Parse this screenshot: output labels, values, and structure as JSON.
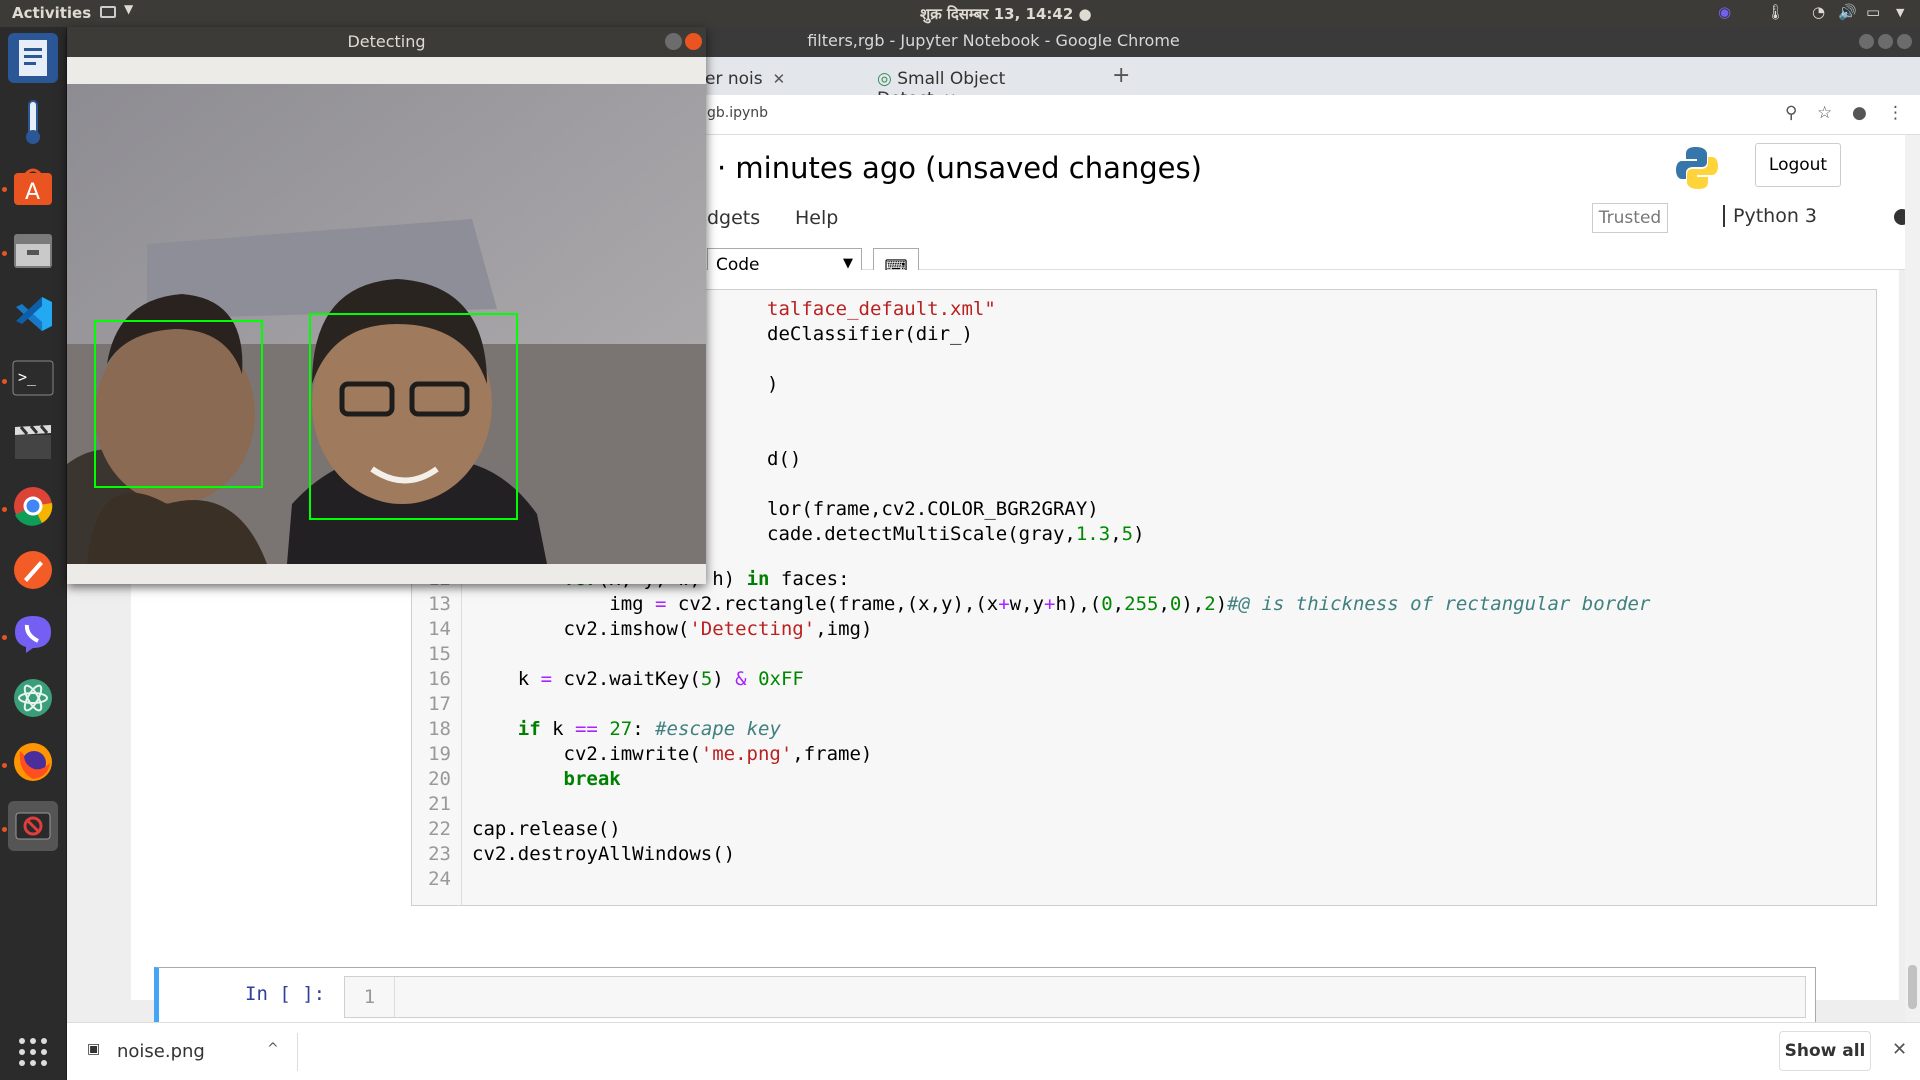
{
  "topbar": {
    "activities": "Activities",
    "clock": "शुक्र दिसम्बर 13, 14:42 ●"
  },
  "browser": {
    "window_title": "filters,rgb - Jupyter Notebook - Google Chrome",
    "tabs": [
      {
        "label": "er nois"
      },
      {
        "label": "Small Object Detect"
      }
    ],
    "url": "gb.ipynb"
  },
  "notebook": {
    "title": "· minutes ago  (unsaved changes)",
    "logout": "Logout",
    "menus": [
      "dgets",
      "Help"
    ],
    "trusted": "Trusted",
    "kernel": "Python 3",
    "cell_type": "Code",
    "keyboard_icon": "⌨",
    "prompt": "In [ ]:",
    "empty_line": "1"
  },
  "detecting": {
    "title": "Detecting"
  },
  "downloads": {
    "file": "noise.png",
    "show_all": "Show all"
  },
  "colors": {
    "accent": "#42a5f5",
    "box": "#00ff00",
    "ubuntu_orange": "#e95420"
  },
  "icons": [
    "docs-icon",
    "thermometer-icon",
    "software-center-icon",
    "files-icon",
    "vscode-icon",
    "terminal-icon",
    "video-editor-icon",
    "chrome-icon",
    "pen-icon",
    "viber-icon",
    "atom-icon",
    "firefox-icon",
    "blocked-app-icon",
    "app-grid-icon"
  ]
}
